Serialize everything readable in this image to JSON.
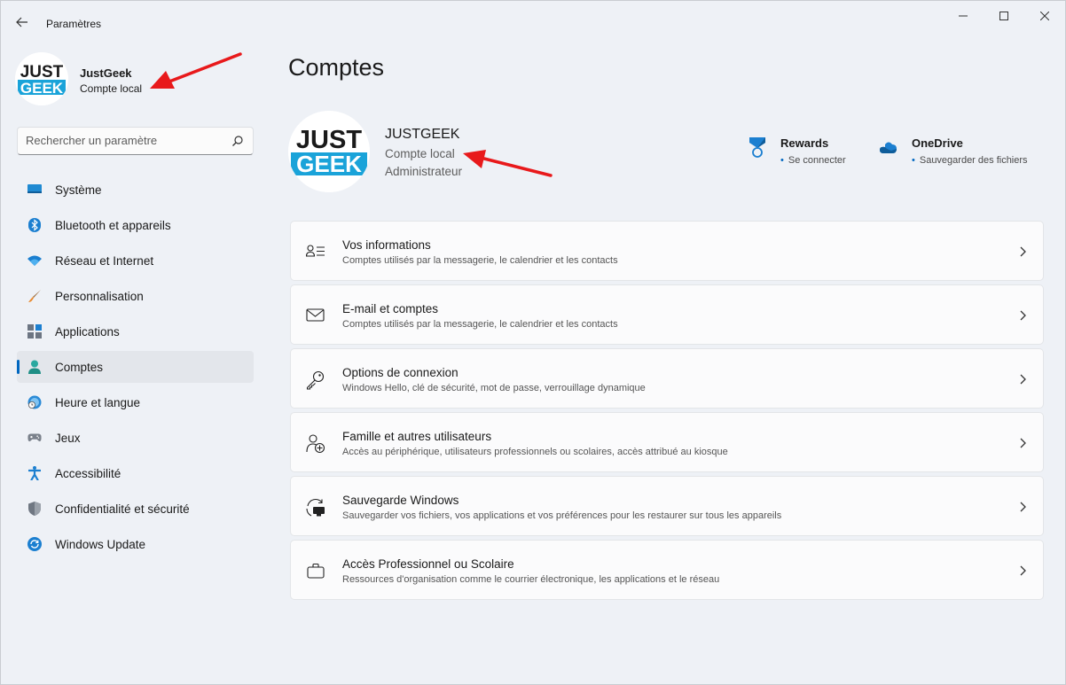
{
  "window": {
    "title": "Paramètres"
  },
  "sidebar": {
    "profile": {
      "name": "JustGeek",
      "type": "Compte local"
    },
    "search": {
      "placeholder": "Rechercher un paramètre"
    },
    "items": [
      {
        "label": "Système",
        "icon": "display-icon"
      },
      {
        "label": "Bluetooth et appareils",
        "icon": "bluetooth-icon"
      },
      {
        "label": "Réseau et Internet",
        "icon": "wifi-icon"
      },
      {
        "label": "Personnalisation",
        "icon": "brush-icon"
      },
      {
        "label": "Applications",
        "icon": "apps-icon"
      },
      {
        "label": "Comptes",
        "icon": "person-icon",
        "active": true
      },
      {
        "label": "Heure et langue",
        "icon": "globe-clock-icon"
      },
      {
        "label": "Jeux",
        "icon": "gamepad-icon"
      },
      {
        "label": "Accessibilité",
        "icon": "accessibility-icon"
      },
      {
        "label": "Confidentialité et sécurité",
        "icon": "shield-icon"
      },
      {
        "label": "Windows Update",
        "icon": "update-icon"
      }
    ]
  },
  "main": {
    "title": "Comptes",
    "account": {
      "name": "JUSTGEEK",
      "type": "Compte local",
      "role": "Administrateur"
    },
    "quick_links": [
      {
        "title": "Rewards",
        "subtitle": "Se connecter",
        "icon": "rewards-medal-icon"
      },
      {
        "title": "OneDrive",
        "subtitle": "Sauvegarder des fichiers",
        "icon": "onedrive-cloud-icon"
      }
    ],
    "cards": [
      {
        "title": "Vos informations",
        "subtitle": "Comptes utilisés par la messagerie, le calendrier et les contacts",
        "icon": "user-info-icon"
      },
      {
        "title": "E-mail et comptes",
        "subtitle": "Comptes utilisés par la messagerie, le calendrier et les contacts",
        "icon": "mail-icon"
      },
      {
        "title": "Options de connexion",
        "subtitle": "Windows Hello, clé de sécurité, mot de passe, verrouillage dynamique",
        "icon": "key-icon"
      },
      {
        "title": "Famille et autres utilisateurs",
        "subtitle": "Accès au périphérique, utilisateurs professionnels ou scolaires, accès attribué au kiosque",
        "icon": "add-user-icon"
      },
      {
        "title": "Sauvegarde Windows",
        "subtitle": "Sauvegarder vos fichiers, vos applications et vos préférences pour les restaurer sur tous les appareils",
        "icon": "backup-icon"
      },
      {
        "title": "Accès Professionnel ou Scolaire",
        "subtitle": "Ressources d'organisation comme le courrier électronique, les applications et le réseau",
        "icon": "briefcase-icon"
      }
    ]
  },
  "logo": {
    "line1": "JUST",
    "line2": "GEEK"
  },
  "colors": {
    "accent": "#0067c0",
    "logo_blue": "#1aa3d9",
    "annotation_red": "#e8191b"
  }
}
